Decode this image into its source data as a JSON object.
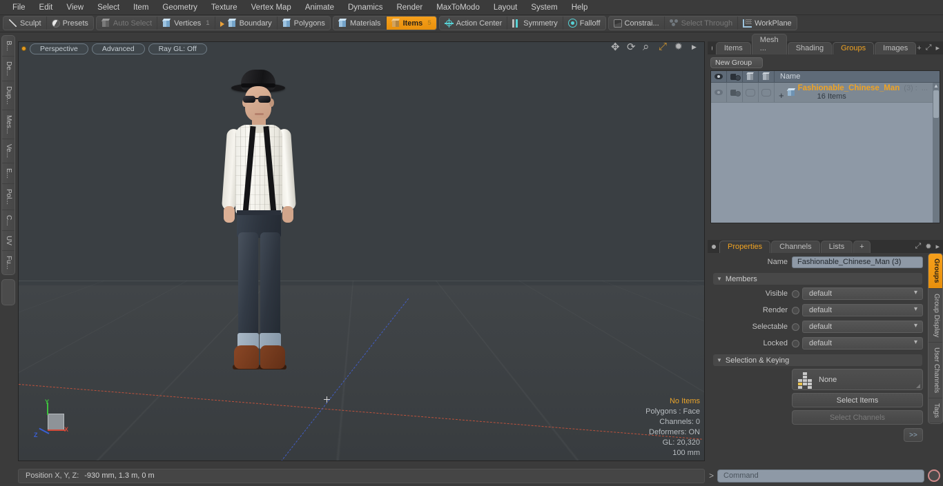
{
  "menubar": {
    "items": [
      "File",
      "Edit",
      "View",
      "Select",
      "Item",
      "Geometry",
      "Texture",
      "Vertex Map",
      "Animate",
      "Dynamics",
      "Render",
      "MaxToModo",
      "Layout",
      "System",
      "Help"
    ]
  },
  "toolbar": {
    "group1": [
      {
        "label": "Sculpt",
        "icon": "sculpt-icon",
        "state": "normal"
      },
      {
        "label": "Presets",
        "icon": "sphere-icon",
        "state": "normal"
      }
    ],
    "group2": [
      {
        "label": "Auto Select",
        "icon": "cube-gray-icon",
        "state": "dim",
        "num": ""
      },
      {
        "label": "Vertices",
        "icon": "cube-blue-icon",
        "state": "normal",
        "num": "1"
      },
      {
        "label": "Boundary",
        "icon": "boundary-icon",
        "state": "normal",
        "num": ""
      },
      {
        "label": "Polygons",
        "icon": "cube-blue-icon",
        "state": "normal",
        "num": ""
      }
    ],
    "group3": [
      {
        "label": "Materials",
        "icon": "cube-blue-icon",
        "state": "normal",
        "num": ""
      },
      {
        "label": "Items",
        "icon": "cube-orange-icon",
        "state": "active",
        "num": "5"
      }
    ],
    "group4": [
      {
        "label": "Action Center",
        "icon": "crosshair-icon",
        "state": "normal"
      },
      {
        "label": "Symmetry",
        "icon": "symmetry-icon",
        "state": "normal"
      },
      {
        "label": "Falloff",
        "icon": "falloff-icon",
        "state": "normal"
      }
    ],
    "group5": [
      {
        "label": "Constrai...",
        "icon": "constrain-icon",
        "state": "normal"
      },
      {
        "label": "Select Through",
        "icon": "select-through-icon",
        "state": "dim"
      }
    ],
    "group6": [
      {
        "label": "WorkPlane",
        "icon": "workplane-icon",
        "state": "normal"
      }
    ]
  },
  "left_tabs": {
    "items": [
      "B...",
      "De...",
      "Dup...",
      "Mes...",
      "Ve...",
      "E...",
      "Pol...",
      "C...",
      "UV",
      "Fu..."
    ]
  },
  "viewport": {
    "pills": [
      "Perspective",
      "Advanced",
      "Ray GL: Off"
    ],
    "nav_icons": [
      "move-icon",
      "rotate-icon",
      "zoom-icon",
      "fit-icon",
      "gear-icon",
      "play-icon"
    ],
    "gizmo": {
      "x": "X",
      "y": "Y",
      "z": "Z"
    },
    "stats": [
      {
        "text": "No Items",
        "highlight": true
      },
      {
        "text": "Polygons : Face",
        "highlight": false
      },
      {
        "text": "Channels: 0",
        "highlight": false
      },
      {
        "text": "Deformers: ON",
        "highlight": false
      },
      {
        "text": "GL: 20,320",
        "highlight": false
      },
      {
        "text": "100 mm",
        "highlight": false
      }
    ]
  },
  "items_panel": {
    "tabs": [
      {
        "label": "Items",
        "active": false
      },
      {
        "label": "Mesh ...",
        "active": false
      },
      {
        "label": "Shading",
        "active": false
      },
      {
        "label": "Groups",
        "active": true
      },
      {
        "label": "Images",
        "active": false
      }
    ],
    "tab_extras": [
      "+",
      "expand-icon",
      "chevron-right-icon"
    ],
    "new_group_button": "New Group",
    "tree": {
      "columns": [
        "eye-icon",
        "render-icon",
        "cube-icon",
        "cube-shaded-icon",
        "Name"
      ],
      "rows": [
        {
          "name": "Fashionable_Chinese_Man",
          "count": "(3) :",
          "ellipsis": "...",
          "sub": "16 Items"
        }
      ]
    }
  },
  "properties_panel": {
    "tabs": [
      {
        "label": "Properties",
        "active": true
      },
      {
        "label": "Channels",
        "active": false
      },
      {
        "label": "Lists",
        "active": false
      },
      {
        "label": "+",
        "active": false
      }
    ],
    "tab_extras": [
      "expand-icon",
      "gear-icon",
      "chevron-right-icon"
    ],
    "name_label": "Name",
    "name_value": "Fashionable_Chinese_Man (3)",
    "members_section": "Members",
    "fields": [
      {
        "label": "Visible",
        "value": "default"
      },
      {
        "label": "Render",
        "value": "default"
      },
      {
        "label": "Selectable",
        "value": "default"
      },
      {
        "label": "Locked",
        "value": "default"
      }
    ],
    "selection_section": "Selection & Keying",
    "keying_value": "None",
    "buttons": [
      {
        "label": "Select Items",
        "enabled": true
      },
      {
        "label": "Select Channels",
        "enabled": false
      }
    ],
    "more_button": ">>"
  },
  "right_tabs": {
    "items": [
      {
        "label": "Groups",
        "active": true
      },
      {
        "label": "Group Display",
        "active": false
      },
      {
        "label": "User Channels",
        "active": false
      },
      {
        "label": "Tags",
        "active": false
      }
    ]
  },
  "statusbar": {
    "label": "Position X, Y, Z:",
    "value": "-930 mm, 1.3 m, 0 m"
  },
  "command_bar": {
    "prompt": ">",
    "placeholder": "Command",
    "led": "record-icon"
  },
  "colors": {
    "accent": "#f0a322",
    "panel_bg": "#3b3b3b",
    "field_bg": "#8e99a6",
    "viewport_bg": "#3a3f43"
  }
}
